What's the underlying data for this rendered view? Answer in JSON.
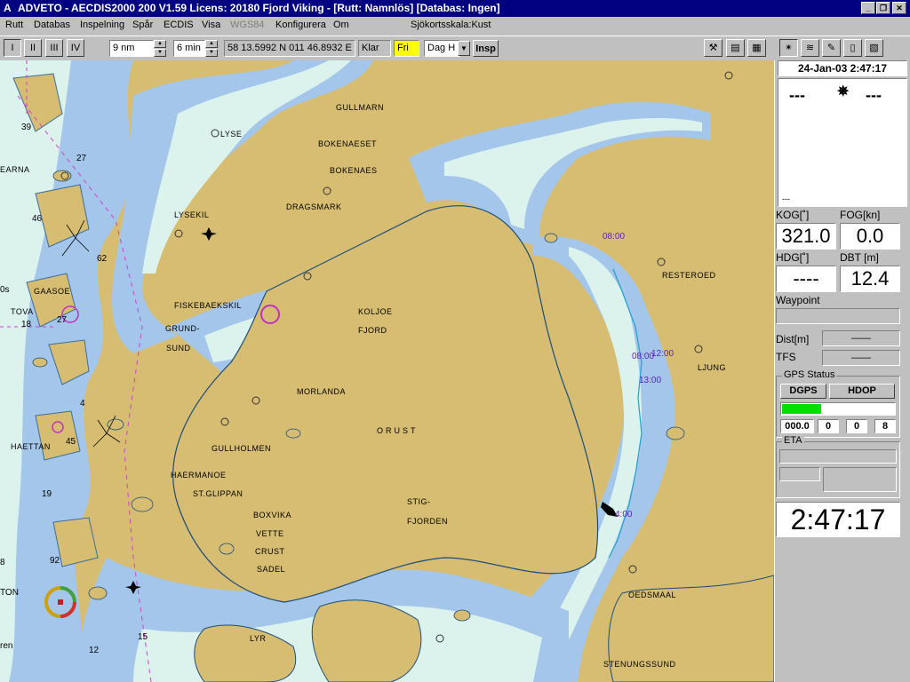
{
  "window": {
    "title": "ADVETO - AECDIS2000 200 V1.59  Licens: 20180 Fjord Viking - [Rutt: Namnlös] [Databas: Ingen]",
    "app_icon": "A"
  },
  "menu": [
    "Rutt",
    "Databas",
    "Inspelning",
    "Spår",
    "ECDIS",
    "Visa",
    "WGS84",
    "Konfigurera",
    "Om"
  ],
  "menu_disabled": "WGS84",
  "chart_scale": "Sjökortsskala:Kust",
  "toolbar": {
    "view_buttons": [
      "I",
      "II",
      "III",
      "IV"
    ],
    "range": "9 nm",
    "time": "6 min",
    "position": "58 13.5992 N  011 46.8932 E",
    "status": "Klar",
    "mode": "Fri",
    "palette": "Dag H",
    "insp": "Insp"
  },
  "panel": {
    "date": "24-Jan-03 2:47:17",
    "compass_left": "---",
    "compass_right": "---",
    "compass_bottom": "---",
    "kog_label": "KOG[˚]",
    "kog": "321.0",
    "fog_label": "FOG[kn]",
    "fog": "0.0",
    "hdg_label": "HDG[˚]",
    "hdg": "----",
    "dbt_label": "DBT [m]",
    "dbt": "12.4",
    "waypoint_label": "Waypoint",
    "waypoint": "",
    "dist_label": "Dist[m]",
    "dist": "——",
    "tfs_label": "TFS",
    "tfs": "——",
    "gps_title": "GPS Status",
    "gps_mode": "DGPS",
    "gps_hdop": "HDOP",
    "gps_signal": 0.55,
    "gps_values": [
      "000.0",
      "0",
      "0",
      "8"
    ],
    "eta_title": "ETA",
    "clock": "2:47:17"
  },
  "places": [
    "GULLMARN",
    "LYSE",
    "BOKENAESET",
    "BOKENAES",
    "DRAGSMARK",
    "LYSEKIL",
    "GAASOE",
    "TOVA",
    "FISKEBAEKSKIL",
    "GRUND-",
    "SUND",
    "KOLJOE",
    "FJORD",
    "RESTEROED",
    "LJUNG",
    "MORLANDA",
    "ORUST",
    "HAETTAN",
    "GULLHOLMEN",
    "HAERMANOE",
    "ST.GLIPPAN",
    "BOXVIKA",
    "VETTE",
    "CRUST",
    "SADEL",
    "STIG-",
    "FJORDEN",
    "OEDSMAAL",
    "LYR",
    "STENUNGSSUND",
    "EARNA"
  ],
  "time_marks": [
    "08:00",
    "12:00",
    "08:00",
    "13:00",
    "4:00"
  ],
  "depths": [
    "3",
    "39",
    "27",
    "46",
    "62",
    "0s",
    "18",
    "27",
    "45",
    "4",
    "19",
    "92",
    "15",
    "12",
    "8",
    "5",
    "44",
    "TON",
    "ren"
  ]
}
